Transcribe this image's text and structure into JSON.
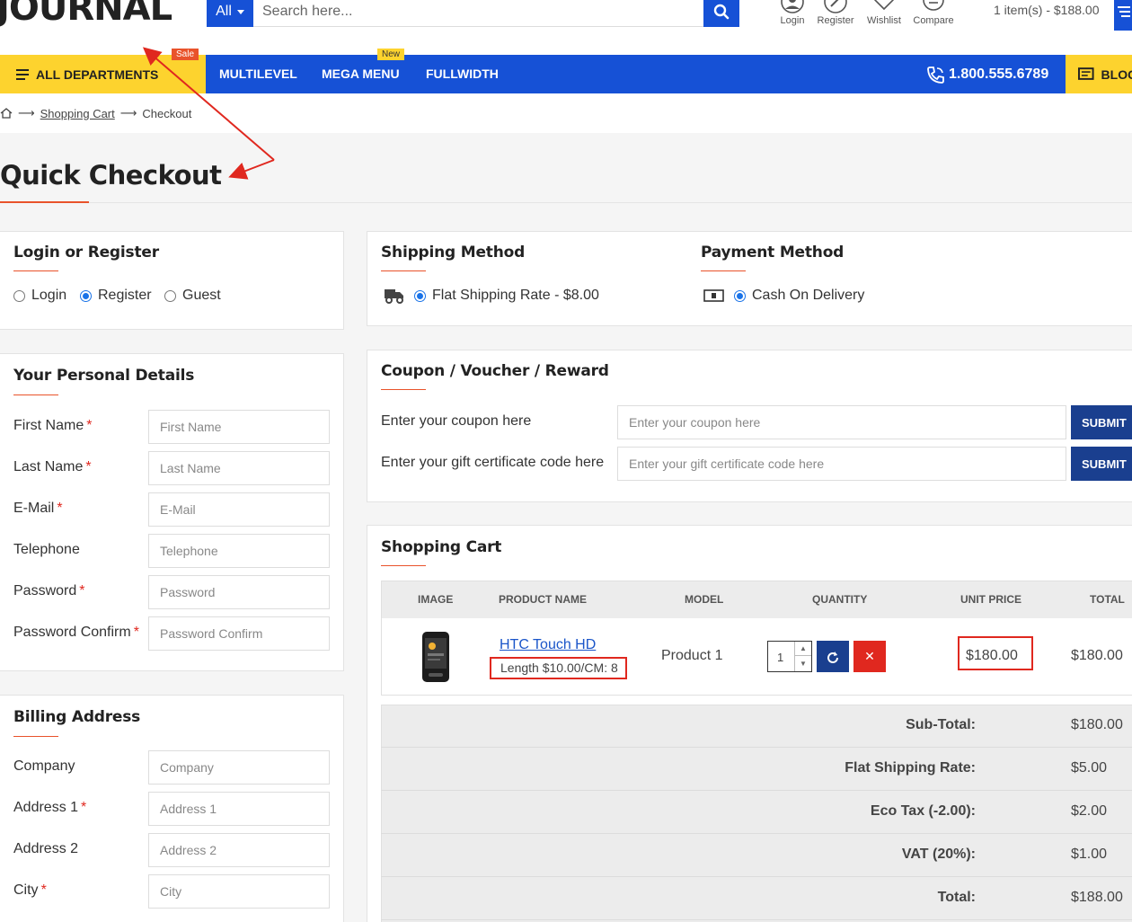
{
  "header": {
    "logo": "JOURNAL",
    "search_category": "All",
    "search_placeholder": "Search here...",
    "links": [
      {
        "label": "Login",
        "icon": "user-icon"
      },
      {
        "label": "Register",
        "icon": "edit-icon"
      },
      {
        "label": "Wishlist",
        "icon": "heart-icon"
      },
      {
        "label": "Compare",
        "icon": "compare-icon"
      }
    ],
    "cart_summary": "1 item(s) - $188.00"
  },
  "nav": {
    "departments": "ALL DEPARTMENTS",
    "sale_badge": "Sale",
    "new_badge": "New",
    "items": [
      "MULTILEVEL",
      "MEGA MENU",
      "FULLWIDTH"
    ],
    "phone": "1.800.555.6789",
    "blog": "BLOG"
  },
  "breadcrumb": {
    "home_icon": "home-icon",
    "shopping_cart": "Shopping Cart",
    "checkout": "Checkout"
  },
  "page_title": "Quick Checkout",
  "login_register": {
    "title": "Login or Register",
    "options": [
      {
        "label": "Login",
        "checked": false
      },
      {
        "label": "Register",
        "checked": true
      },
      {
        "label": "Guest",
        "checked": false
      }
    ]
  },
  "shipping": {
    "title": "Shipping Method",
    "option": "Flat Shipping Rate - $8.00",
    "icon": "truck-icon"
  },
  "payment": {
    "title": "Payment Method",
    "option": "Cash On Delivery",
    "icon": "cash-icon"
  },
  "personal": {
    "title": "Your Personal Details",
    "fields": [
      {
        "label": "First Name",
        "placeholder": "First Name",
        "required": "*"
      },
      {
        "label": "Last Name",
        "placeholder": "Last Name",
        "required": "*"
      },
      {
        "label": "E-Mail",
        "placeholder": "E-Mail",
        "required": "*"
      },
      {
        "label": "Telephone",
        "placeholder": "Telephone",
        "required": ""
      },
      {
        "label": "Password",
        "placeholder": "Password",
        "required": "*"
      },
      {
        "label": "Password Confirm",
        "placeholder": "Password Confirm",
        "required": "*"
      }
    ]
  },
  "billing": {
    "title": "Billing Address",
    "fields": [
      {
        "label": "Company",
        "placeholder": "Company",
        "required": ""
      },
      {
        "label": "Address 1",
        "placeholder": "Address 1",
        "required": "*"
      },
      {
        "label": "Address 2",
        "placeholder": "Address 2",
        "required": ""
      },
      {
        "label": "City",
        "placeholder": "City",
        "required": "*"
      }
    ]
  },
  "coupon": {
    "title": "Coupon / Voucher / Reward",
    "coupon_label": "Enter your coupon here",
    "coupon_placeholder": "Enter your coupon here",
    "gift_label": "Enter your gift certificate code here",
    "gift_placeholder": "Enter your gift certificate code here",
    "submit": "SUBMIT"
  },
  "cart": {
    "title": "Shopping Cart",
    "columns": [
      "IMAGE",
      "PRODUCT NAME",
      "MODEL",
      "QUANTITY",
      "UNIT PRICE",
      "TOTAL"
    ],
    "item": {
      "name": "HTC Touch HD",
      "option": "Length $10.00/CM: 8",
      "model": "Product 1",
      "quantity": "1",
      "unit_price": "$180.00",
      "total": "$180.00"
    },
    "totals": [
      {
        "label": "Sub-Total:",
        "value": "$180.00"
      },
      {
        "label": "Flat Shipping Rate:",
        "value": "$5.00"
      },
      {
        "label": "Eco Tax (-2.00):",
        "value": "$2.00"
      },
      {
        "label": "VAT (20%):",
        "value": "$1.00"
      },
      {
        "label": "Total:",
        "value": "$188.00"
      }
    ]
  },
  "colors": {
    "brand_blue": "#1651d6",
    "accent_yellow": "#fdd32e",
    "accent_orange": "#e9532b",
    "annotation_red": "#e0281f"
  }
}
